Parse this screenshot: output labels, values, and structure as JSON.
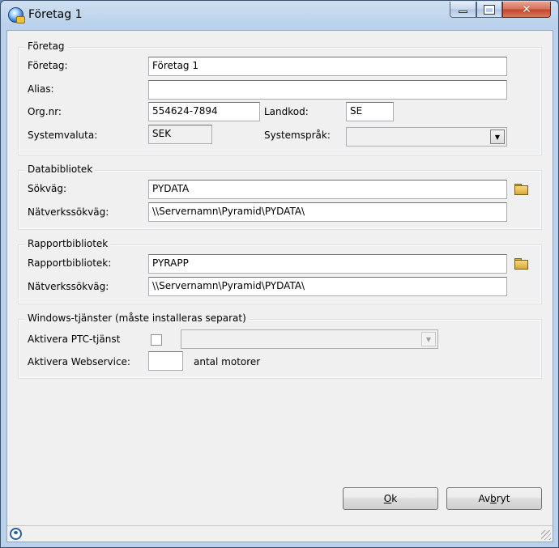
{
  "window": {
    "title": "Företag  1"
  },
  "foretag": {
    "group_title": "Företag",
    "foretag_label": "Företag:",
    "foretag_value": "Företag 1",
    "alias_label": "Alias:",
    "alias_value": "",
    "orgnr_label": "Org.nr:",
    "orgnr_value": "554624-7894",
    "landkod_label": "Landkod:",
    "landkod_value": "SE",
    "systemvaluta_label": "Systemvaluta:",
    "systemvaluta_value": "SEK",
    "systemsprak_label": "Systemspråk:",
    "systemsprak_value": ""
  },
  "databibliotek": {
    "group_title": "Databibliotek",
    "sokvag_label": "Sökväg:",
    "sokvag_value": "PYDATA",
    "natverk_label": "Nätverkssökväg:",
    "natverk_value": "\\\\Servernamn\\Pyramid\\PYDATA\\"
  },
  "rapportbibliotek": {
    "group_title": "Rapportbibliotek",
    "rapport_label": "Rapportbibliotek:",
    "rapport_value": "PYRAPP",
    "natverk_label": "Nätverkssökväg:",
    "natverk_value": "\\\\Servernamn\\Pyramid\\PYDATA\\"
  },
  "windows_tjanster": {
    "group_title": "Windows-tjänster (måste installeras separat)",
    "ptc_label": "Aktivera PTC-tjänst",
    "ptc_checked": false,
    "ptc_combo_value": "",
    "webservice_label": "Aktivera Webservice:",
    "webservice_value": "",
    "motorer_label": "antal motorer"
  },
  "buttons": {
    "ok_mnemonic": "O",
    "ok_rest": "k",
    "avbryt_pre": "Av",
    "avbryt_mnemonic": "b",
    "avbryt_rest": "ryt"
  },
  "colors": {
    "title_bar": "#b9d1ea",
    "dialog_bg": "#f0f0f0",
    "close_button": "#c1442a"
  }
}
